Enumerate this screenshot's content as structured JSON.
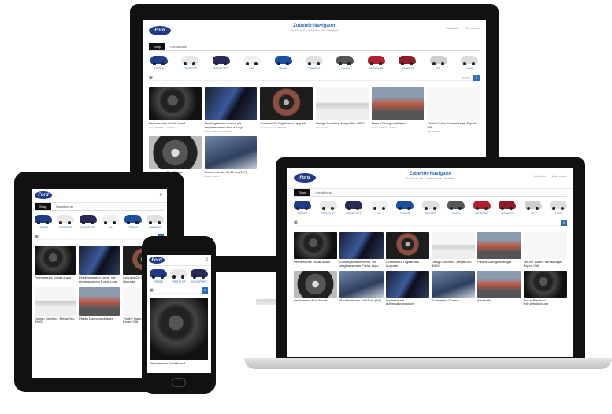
{
  "site": {
    "brand": "Ford",
    "title": "Zubehör-Navigator",
    "subtitle": "Ihr Shop für Zubehör und Lifestyle",
    "links": [
      "Merkliste",
      "Warenkorb"
    ],
    "tabs": [
      "Shop",
      "Handbücher"
    ],
    "search_placeholder": "Suche",
    "search_icon": "search-icon"
  },
  "cars": [
    {
      "label": "FIESTA",
      "color": "#1f3c88"
    },
    {
      "label": "FIESTA ST",
      "color": "#e8e8e8"
    },
    {
      "label": "ECOSPORT",
      "color": "#2a2a5a"
    },
    {
      "label": "KA",
      "color": "#f0f0f0"
    },
    {
      "label": "FOCUS",
      "color": "#1c4fa0"
    },
    {
      "label": "RANGER",
      "color": "#e0e0e0"
    },
    {
      "label": "KUGA",
      "color": "#555555"
    },
    {
      "label": "MUSTANG",
      "color": "#b02030"
    },
    {
      "label": "MONDEO",
      "color": "#8c1c28"
    },
    {
      "label": "GT",
      "color": "#cfcfcf"
    },
    {
      "label": "C-MAX",
      "color": "#dddddd"
    }
  ],
  "products": [
    {
      "name": "Performance Schalt-knauf",
      "sub": "Kuga 03/2016 – 10/2019",
      "thumb": "th-knob"
    },
    {
      "name": "Einstiegsleisten vorne, mit eingelassenem Focus-Logo",
      "sub": "Focus 01/2018 – 03/2022",
      "thumb": "th-sill"
    },
    {
      "name": "Connects20 Digitalradio Upgrade",
      "sub": "Transit Connect 06/2018",
      "thumb": "th-box"
    },
    {
      "name": "Design Dachbox „Mega/Orio 300G“",
      "sub": "Alle Modelle",
      "thumb": "th-roof"
    },
    {
      "name": "Pleska Dachgrundträger",
      "sub": "Fiesta 07/2017 – 5-Türer",
      "thumb": "th-rack"
    },
    {
      "name": "Thule® Dach-Fahrradträger Expert 298",
      "sub": "Alle Modelle",
      "thumb": "th-bike"
    },
    {
      "name": "Leichtmetall-Rad-Ersatz",
      "sub": "Fiesta 07/2017",
      "thumb": "th-wheel"
    },
    {
      "name": "Radzierblende 40,64 cm (16\")",
      "sub": "Fiesta 07/2017",
      "thumb": "th-car2"
    }
  ],
  "laptop_products": [
    {
      "name": "Performance Schalt-knauf",
      "thumb": "th-knob"
    },
    {
      "name": "Einstiegsleisten vorne, mit eingelassenem Focus-Logo",
      "thumb": "th-sill"
    },
    {
      "name": "Connects20 Digitalradio Upgrade",
      "thumb": "th-box"
    },
    {
      "name": "Design Dachbox „Mega/Orio 300G“",
      "thumb": "th-roof"
    },
    {
      "name": "Pleska Dachgrundträger",
      "thumb": "th-rack"
    },
    {
      "name": "Thule® Dach-Fahrradträger Expert 298",
      "thumb": "th-bike"
    },
    {
      "name": "Leichtmetall-Rad-Ersatz",
      "thumb": "th-wheel"
    },
    {
      "name": "Radzierblende 40,64 cm (16\")",
      "thumb": "th-car2"
    },
    {
      "name": "Armlehne mit Aufbewahrungsfach",
      "thumb": "th-sill"
    },
    {
      "name": "Fußmatten, Gummi",
      "thumb": "th-car2"
    },
    {
      "name": "Kindersitz",
      "thumb": "th-rack"
    },
    {
      "name": "Focus Premium Schutzbekleidung",
      "thumb": "th-knob"
    }
  ],
  "phone_product": {
    "name": "Performance Schaltknauf"
  }
}
